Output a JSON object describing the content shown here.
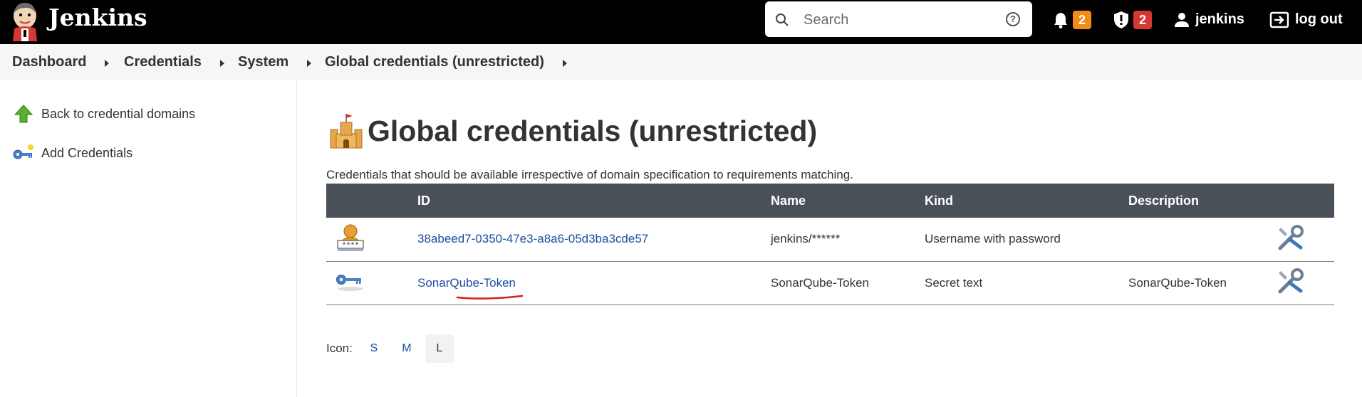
{
  "header": {
    "brand": "Jenkins",
    "search": {
      "placeholder": "Search"
    },
    "notifications": {
      "count": "2"
    },
    "security": {
      "count": "2"
    },
    "user": "jenkins",
    "logout": "log out"
  },
  "breadcrumb": [
    "Dashboard",
    "Credentials",
    "System",
    "Global credentials (unrestricted)"
  ],
  "side": {
    "back": "Back to credential domains",
    "add": "Add Credentials"
  },
  "main": {
    "title": "Global credentials (unrestricted)",
    "description": "Credentials that should be available irrespective of domain specification to requirements matching.",
    "columns": [
      "ID",
      "Name",
      "Kind",
      "Description"
    ],
    "rows": [
      {
        "id": "38abeed7-0350-47e3-a8a6-05d3ba3cde57",
        "name": "jenkins/******",
        "kind": "Username with password",
        "description": "",
        "icon": "user-password-icon"
      },
      {
        "id": "SonarQube-Token",
        "name": "SonarQube-Token",
        "kind": "Secret text",
        "description": "SonarQube-Token",
        "icon": "key-icon"
      }
    ],
    "icon_size": {
      "label": "Icon:",
      "options": [
        "S",
        "M",
        "L"
      ],
      "selected": "L"
    }
  },
  "colors": {
    "header_bg": "#000000",
    "link": "#1b4ea0",
    "table_header": "#4a5058",
    "badge_orange": "#f28c18",
    "badge_red": "#d33833",
    "annotation": "#d42020"
  }
}
